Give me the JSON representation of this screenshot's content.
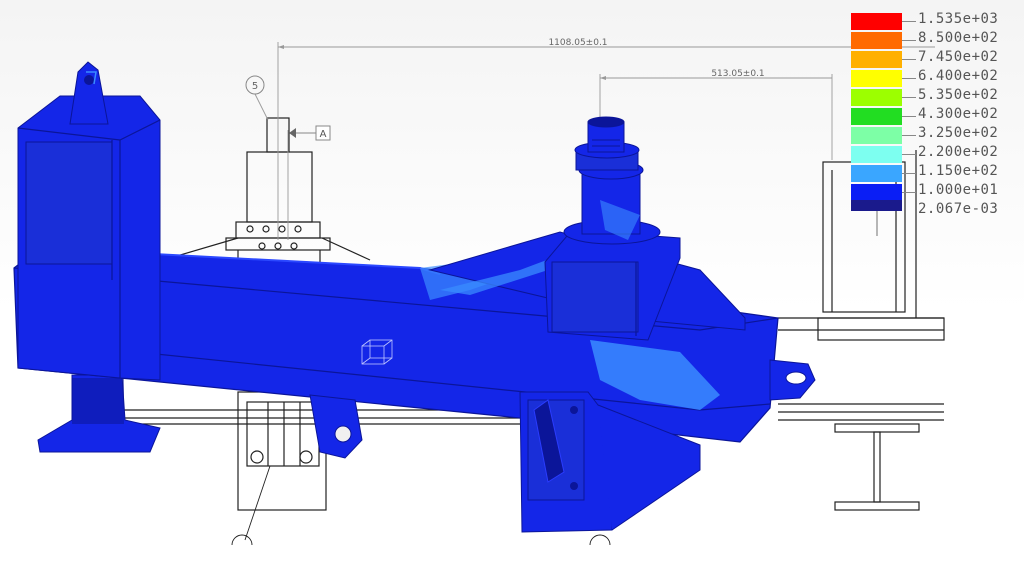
{
  "legend": {
    "entries": [
      {
        "label": "1.535e+03",
        "color": "#ff0000"
      },
      {
        "label": "8.500e+02",
        "color": "#ff6a00"
      },
      {
        "label": "7.450e+02",
        "color": "#ffb000"
      },
      {
        "label": "6.400e+02",
        "color": "#ffff00"
      },
      {
        "label": "5.350e+02",
        "color": "#9cff00"
      },
      {
        "label": "4.300e+02",
        "color": "#22dd22"
      },
      {
        "label": "3.250e+02",
        "color": "#7dffa6"
      },
      {
        "label": "2.200e+02",
        "color": "#7dfff0"
      },
      {
        "label": "1.150e+02",
        "color": "#3aa6ff"
      },
      {
        "label": "1.000e+01",
        "color": "#0a1ef5"
      },
      {
        "label": "2.067e-03",
        "color": "#1a1a8c"
      }
    ]
  },
  "drawing": {
    "dim_overall": "1108.05±0.1",
    "dim_pin": "513.05±0.1",
    "balloon_number": "5",
    "datum_label": "A"
  },
  "colors": {
    "stress_base": "#1426e8",
    "stress_dark": "#0b1599",
    "stress_light": "#3a8cff",
    "line_art": "#222222",
    "dimension_line": "#999999"
  }
}
